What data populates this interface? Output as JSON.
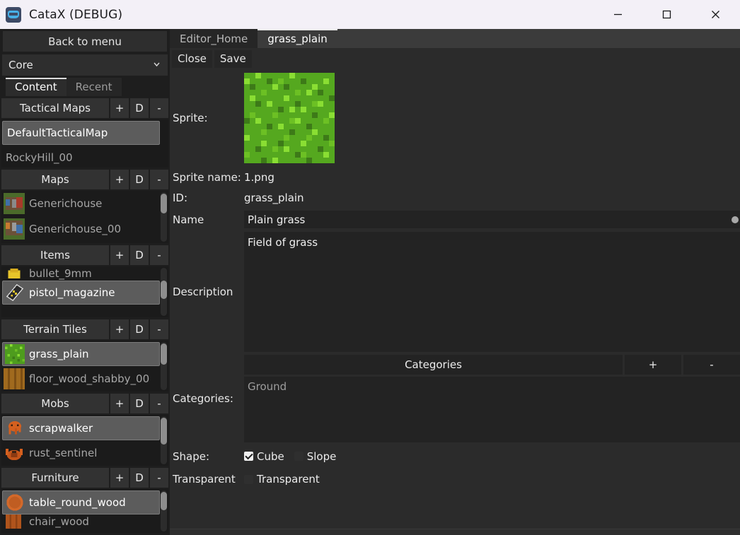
{
  "window": {
    "title": "CataX (DEBUG)",
    "icon": "godot-robot-icon",
    "minimize": "minimize-icon",
    "maximize": "maximize-icon",
    "close": "close-icon"
  },
  "sidebar": {
    "back_button": "Back to menu",
    "mod_selected": "Core",
    "mod_dropdown_icon": "chevron-down-icon",
    "tabs": [
      {
        "label": "Content",
        "active": true
      },
      {
        "label": "Recent",
        "active": false
      }
    ],
    "add_label": "+",
    "duplicate_label": "D",
    "remove_label": "-",
    "sections": [
      {
        "title": "Tactical Maps",
        "items": [
          {
            "label": "DefaultTacticalMap",
            "selected": true,
            "icon": null
          },
          {
            "label": "RockyHill_00",
            "selected": false,
            "icon": null
          }
        ]
      },
      {
        "title": "Maps",
        "items": [
          {
            "label": "Generichouse",
            "selected": false,
            "icon": "map-thumbnail"
          },
          {
            "label": "Generichouse_00",
            "selected": false,
            "icon": "map-thumbnail"
          }
        ]
      },
      {
        "title": "Items",
        "items": [
          {
            "label": "bullet_9mm",
            "selected": false,
            "icon": "bullet-thumbnail"
          },
          {
            "label": "pistol_magazine",
            "selected": true,
            "icon": "magazine-thumbnail"
          }
        ]
      },
      {
        "title": "Terrain Tiles",
        "items": [
          {
            "label": "grass_plain",
            "selected": true,
            "icon": "grass-thumbnail"
          },
          {
            "label": "floor_wood_shabby_00",
            "selected": false,
            "icon": "wood-floor-thumbnail"
          }
        ]
      },
      {
        "title": "Mobs",
        "items": [
          {
            "label": "scrapwalker",
            "selected": true,
            "icon": "scrapwalker-thumbnail"
          },
          {
            "label": "rust_sentinel",
            "selected": false,
            "icon": "rust-sentinel-thumbnail"
          }
        ]
      },
      {
        "title": "Furniture",
        "items": [
          {
            "label": "table_round_wood",
            "selected": true,
            "icon": "round-table-thumbnail"
          },
          {
            "label": "chair_wood",
            "selected": false,
            "icon": "wood-chair-thumbnail"
          }
        ]
      }
    ]
  },
  "editor": {
    "tabs": [
      {
        "label": "Editor_Home",
        "active": false
      },
      {
        "label": "grass_plain",
        "active": true
      }
    ],
    "toolbar": {
      "close_label": "Close",
      "save_label": "Save"
    },
    "fields": {
      "sprite_label": "Sprite:",
      "sprite_icon": "grass-sprite-preview",
      "sprite_name_label": "Sprite name:",
      "sprite_name_value": "1.png",
      "id_label": "ID:",
      "id_value": "grass_plain",
      "name_label": "Name",
      "name_value": "Plain grass",
      "description_label": "Description",
      "description_value": "Field of grass",
      "categories_label": "Categories:",
      "categories_header": "Categories",
      "categories_add": "+",
      "categories_remove": "-",
      "categories_items": [
        "Ground"
      ],
      "shape_label": "Shape:",
      "shape_options": [
        {
          "label": "Cube",
          "checked": true
        },
        {
          "label": "Slope",
          "checked": false
        }
      ],
      "transparent_label": "Transparent",
      "transparent_option": {
        "label": "Transparent",
        "checked": false
      }
    }
  },
  "colors": {
    "titlebar_bg": "#f3f0f7",
    "panel_bg": "#2b2b2b",
    "sidebar_bg": "#1e1e1e",
    "input_bg": "#232323",
    "selection_bg": "#5c5c5c",
    "text_primary": "#ededed",
    "text_muted": "#9d9d9d",
    "grass_green": "#5fbd2a"
  }
}
